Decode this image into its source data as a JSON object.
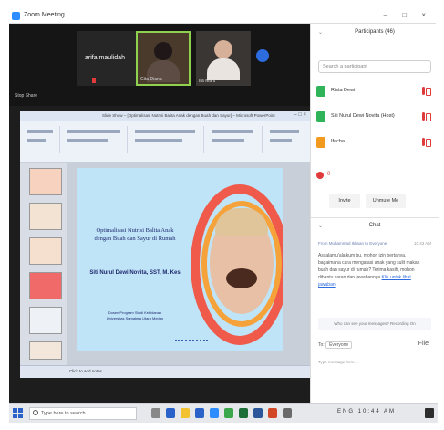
{
  "window": {
    "title": "Zoom Meeting",
    "controls": "– □ ×"
  },
  "gallery": {
    "tiles": [
      {
        "name": "arifa maulidah"
      },
      {
        "name": "Gita Diana"
      },
      {
        "name": "Ira Marti"
      }
    ],
    "sharing_label": "Stop Share"
  },
  "powerpoint": {
    "title": "Slide Show – [Optimalisasi Nutrisi Balita Anak dengan Buah dan Sayur] – Microsoft PowerPoint",
    "controls": "– □ ×",
    "notes_placeholder": "Click to add notes"
  },
  "slide": {
    "title": "Optimalisasi Nutrisi Balita Anak dengan Buah dan Sayur di Rumah",
    "author": "Siti Nurul Dewi Novita, SST, M. Kes",
    "footer_line1": "Dosen Program Studi Kebidanan",
    "footer_line2": "Universitas Sumatera Utara Medan"
  },
  "participants": {
    "header": "Participants (46)",
    "search_placeholder": "Search a participant",
    "list": [
      {
        "name": "Rista Dewi",
        "color": "#2fb45a"
      },
      {
        "name": "Siti Nurul Dewi Novita (Host)",
        "color": "#2fb45a"
      },
      {
        "name": "Ifacha",
        "color": "#f29a1e"
      }
    ],
    "host_count": "0",
    "invite_label": "Invite",
    "unmute_label": "Unmute Me"
  },
  "chat": {
    "header": "Chat",
    "from": "From Muhammad Ikhsan to Everyone",
    "time": "10:43 AM",
    "message": "Assalamu'alaikum bu, mohon izin bertanya, bagaimana cara mengatasi anak yang sulit makan buah dan sayur di rumah? Terima kasih, mohon dibantu saran dan jawabannya",
    "link": "Klik untuk lihat jawaban",
    "notice": "Who can see your messages? Recording On",
    "to_label": "To:",
    "to_value": "Everyone",
    "file_label": "File",
    "input_placeholder": "Type message here..."
  },
  "taskbar": {
    "search_placeholder": "Type here to search",
    "tray": "ENG  10:44 AM"
  }
}
